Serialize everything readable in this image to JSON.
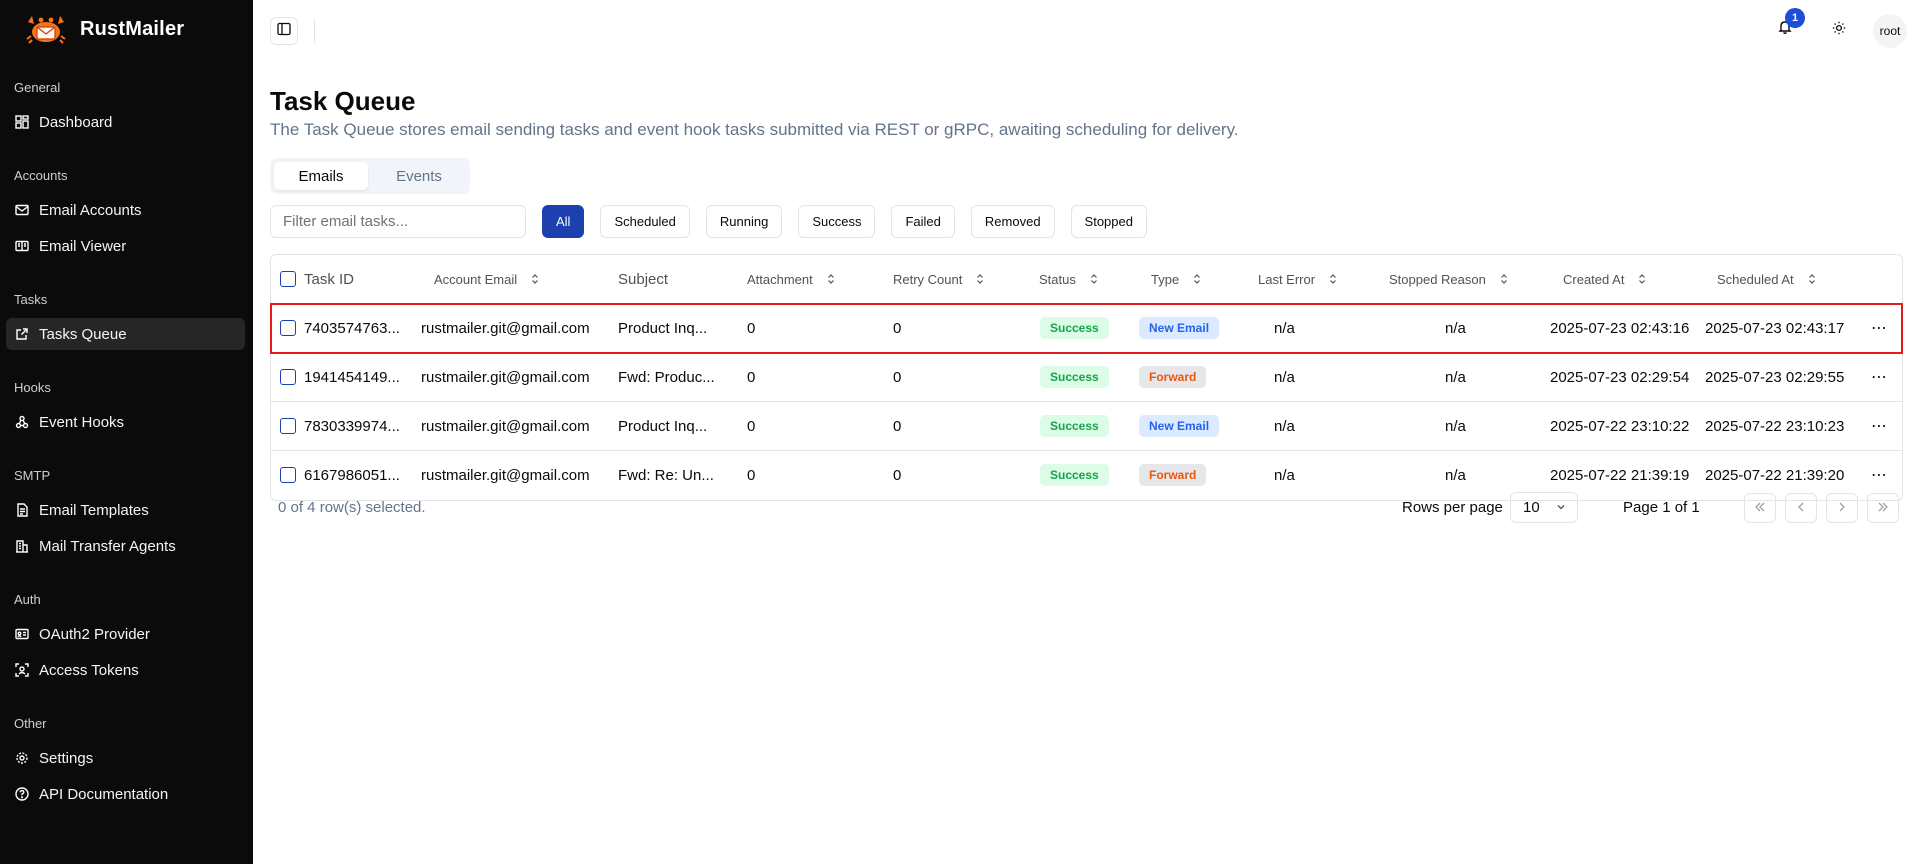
{
  "app": {
    "name": "RustMailer",
    "logo": "crab-mail-logo"
  },
  "sidebar": {
    "groups": [
      {
        "label": "General",
        "items": [
          {
            "label": "Dashboard",
            "icon": "dashboard-icon"
          }
        ]
      },
      {
        "label": "Accounts",
        "items": [
          {
            "label": "Email Accounts",
            "icon": "mail-icon"
          },
          {
            "label": "Email Viewer",
            "icon": "book-open-icon"
          }
        ]
      },
      {
        "label": "Tasks",
        "items": [
          {
            "label": "Tasks Queue",
            "icon": "external-link-icon",
            "active": true
          }
        ]
      },
      {
        "label": "Hooks",
        "items": [
          {
            "label": "Event Hooks",
            "icon": "webhook-icon"
          }
        ]
      },
      {
        "label": "SMTP",
        "items": [
          {
            "label": "Email Templates",
            "icon": "file-text-icon"
          },
          {
            "label": "Mail Transfer Agents",
            "icon": "building-icon"
          }
        ]
      },
      {
        "label": "Auth",
        "items": [
          {
            "label": "OAuth2 Provider",
            "icon": "id-card-icon"
          },
          {
            "label": "Access Tokens",
            "icon": "scan-face-icon"
          }
        ]
      },
      {
        "label": "Other",
        "items": [
          {
            "label": "Settings",
            "icon": "gear-icon"
          },
          {
            "label": "API Documentation",
            "icon": "help-circle-icon"
          }
        ]
      }
    ]
  },
  "topbar": {
    "notifications_count": "1",
    "user": "root"
  },
  "page": {
    "title": "Task Queue",
    "description": "The Task Queue stores email sending tasks and event hook tasks submitted via REST or gRPC, awaiting scheduling for delivery."
  },
  "tabs": [
    {
      "label": "Emails",
      "active": true
    },
    {
      "label": "Events",
      "active": false
    }
  ],
  "filter": {
    "placeholder": "Filter email tasks...",
    "value": ""
  },
  "status_filters": [
    "All",
    "Scheduled",
    "Running",
    "Success",
    "Failed",
    "Removed",
    "Stopped"
  ],
  "table": {
    "columns": [
      "Task ID",
      "Account Email",
      "Subject",
      "Attachment",
      "Retry Count",
      "Status",
      "Type",
      "Last Error",
      "Stopped Reason",
      "Created At",
      "Scheduled At"
    ],
    "rows": [
      {
        "task_id": "7403574763...",
        "account_email": "rustmailer.git@gmail.com",
        "subject": "Product Inq...",
        "attachment": "0",
        "retry_count": "0",
        "status": "Success",
        "type": "New Email",
        "last_error": "n/a",
        "stopped_reason": "n/a",
        "created_at": "2025-07-23 02:43:16",
        "scheduled_at": "2025-07-23 02:43:17"
      },
      {
        "task_id": "1941454149...",
        "account_email": "rustmailer.git@gmail.com",
        "subject": "Fwd: Produc...",
        "attachment": "0",
        "retry_count": "0",
        "status": "Success",
        "type": "Forward",
        "last_error": "n/a",
        "stopped_reason": "n/a",
        "created_at": "2025-07-23 02:29:54",
        "scheduled_at": "2025-07-23 02:29:55"
      },
      {
        "task_id": "7830339974...",
        "account_email": "rustmailer.git@gmail.com",
        "subject": "Product Inq...",
        "attachment": "0",
        "retry_count": "0",
        "status": "Success",
        "type": "New Email",
        "last_error": "n/a",
        "stopped_reason": "n/a",
        "created_at": "2025-07-22 23:10:22",
        "scheduled_at": "2025-07-22 23:10:23"
      },
      {
        "task_id": "6167986051...",
        "account_email": "rustmailer.git@gmail.com",
        "subject": "Fwd: Re: Un...",
        "attachment": "0",
        "retry_count": "0",
        "status": "Success",
        "type": "Forward",
        "last_error": "n/a",
        "stopped_reason": "n/a",
        "created_at": "2025-07-22 21:39:19",
        "scheduled_at": "2025-07-22 21:39:20"
      }
    ],
    "more_label": "⋯"
  },
  "footer": {
    "selected": "0 of 4 row(s) selected.",
    "rows_per_page_label": "Rows per page",
    "rows_per_page_value": "10",
    "page_info": "Page 1 of 1"
  },
  "colors": {
    "accent": "#1e40af",
    "sidebar_bg": "#0b0b0b",
    "highlight_border": "#e11d1d",
    "success": "#16a34a",
    "new_email": "#2563eb",
    "forward": "#ea580c"
  }
}
